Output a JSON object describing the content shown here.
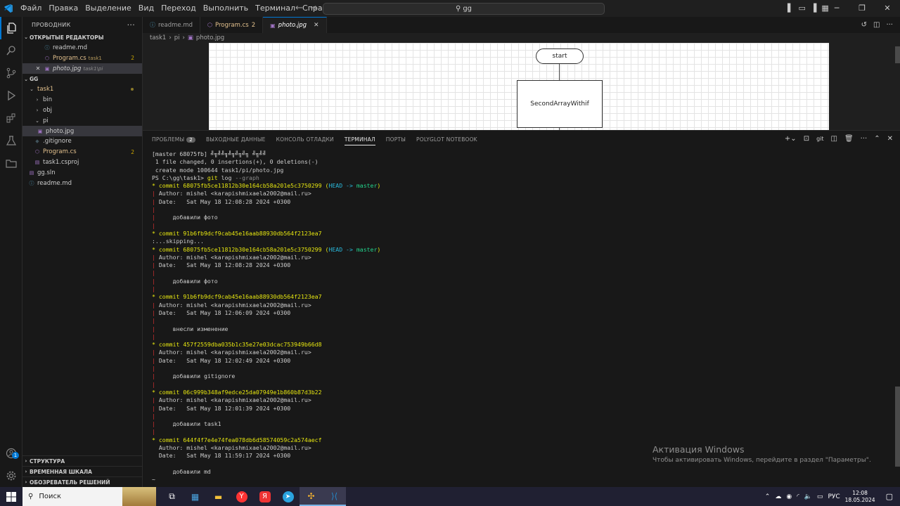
{
  "titlebar": {
    "menu": [
      "Файл",
      "Правка",
      "Выделение",
      "Вид",
      "Переход",
      "Выполнить",
      "Терминал",
      "Справка"
    ],
    "search_text": "gg"
  },
  "sidebar": {
    "title": "ПРОВОДНИК",
    "open_editors_label": "ОТКРЫТЫЕ РЕДАКТОРЫ",
    "open_editors": [
      {
        "name": "readme.md",
        "sub": "",
        "count": ""
      },
      {
        "name": "Program.cs",
        "sub": "task1",
        "count": "2"
      },
      {
        "name": "photo.jpg",
        "sub": "task1\\pi",
        "count": ""
      }
    ],
    "workspace_label": "GG",
    "tree": {
      "task1": "task1",
      "bin": "bin",
      "obj": "obj",
      "pi": "pi",
      "photo": "photo.jpg",
      "gitignore": ".gitignore",
      "program": "Program.cs",
      "program_count": "2",
      "csproj": "task1.csproj",
      "sln": "gg.sln",
      "readme": "readme.md"
    },
    "bottom_sections": [
      "СТРУКТУРА",
      "ВРЕМЕННАЯ ШКАЛА",
      "ОБОЗРЕВАТЕЛЬ РЕШЕНИЙ"
    ]
  },
  "tabs": [
    {
      "label": "readme.md",
      "badge": ""
    },
    {
      "label": "Program.cs",
      "badge": "2"
    },
    {
      "label": "photo.jpg",
      "badge": ""
    }
  ],
  "breadcrumb": [
    "task1",
    "pi",
    "photo.jpg"
  ],
  "image": {
    "start_label": "start",
    "box_label": "SecondArrayWithif"
  },
  "panel": {
    "tabs": [
      "ПРОБЛЕМЫ",
      "ВЫХОДНЫЕ ДАННЫЕ",
      "КОНСОЛЬ ОТЛАДКИ",
      "ТЕРМИНАЛ",
      "ПОРТЫ",
      "POLYGLOT NOTEBOOK"
    ],
    "problems_count": "2",
    "git_label": "git"
  },
  "terminal": {
    "lines": [
      "[master 68075fb] ╝╗╝╝╗╝╗╝╗╝╗ ╝╗╝╝",
      " 1 file changed, 0 insertions(+), 0 deletions(-)",
      " create mode 100644 task1/pi/photo.jpg",
      "PS C:\\gg\\task1> git log --graph",
      "* commit 68075fb5ce11812b30e164cb58a201e5c3750299 (HEAD -> master)",
      "| Author: mishel <karapishmixaela2002@mail.ru>",
      "| Date:   Sat May 18 12:08:28 2024 +0300",
      "|",
      "|     добавили фото",
      "|",
      "* commit 91b6fb9dcf9cab45e16aab88930db564f2123ea7",
      ":...skipping...",
      "* commit 68075fb5ce11812b30e164cb58a201e5c3750299 (HEAD -> master)",
      "| Author: mishel <karapishmixaela2002@mail.ru>",
      "| Date:   Sat May 18 12:08:28 2024 +0300",
      "|",
      "|     добавили фото",
      "|",
      "* commit 91b6fb9dcf9cab45e16aab88930db564f2123ea7",
      "| Author: mishel <karapishmixaela2002@mail.ru>",
      "| Date:   Sat May 18 12:06:09 2024 +0300",
      "|",
      "|     внесли изменение",
      "|",
      "* commit 457f2559dba035b1c35e27e03dcac753949b66d8",
      "| Author: mishel <karapishmixaela2002@mail.ru>",
      "| Date:   Sat May 18 12:02:49 2024 +0300",
      "|",
      "|     добавили gitignore",
      "|",
      "* commit 06c999b348af9edce25da07949e1b860b87d3b22",
      "| Author: mishel <karapishmixaela2002@mail.ru>",
      "| Date:   Sat May 18 12:01:39 2024 +0300",
      "|",
      "|     добавили task1",
      "|",
      "* commit 644f4f7e4e74fea078db6d58574059c2a574aecf",
      "  Author: mishel <karapishmixaela2002@mail.ru>",
      "  Date:   Sat May 18 11:59:17 2024 +0300",
      "",
      "      добавили md",
      "~"
    ]
  },
  "activation": {
    "title": "Активация Windows",
    "subtitle": "Чтобы активировать Windows, перейдите в раздел \"Параметры\"."
  },
  "taskbar": {
    "search_label": "Поиск",
    "language": "РУС",
    "time": "12:08",
    "date": "18.05.2024"
  },
  "colors": {
    "accent": "#0078d4",
    "commit_yellow": "#e5e510",
    "head_cyan": "#29b8db",
    "branch_green": "#23d18b",
    "graph_red": "#cd3131"
  }
}
